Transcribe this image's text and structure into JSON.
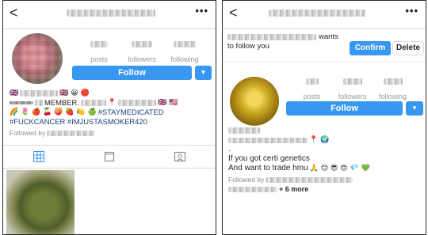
{
  "left": {
    "nav": {
      "back_icon": "chevron-left-icon",
      "back_glyph": "<",
      "more_glyph": "•••"
    },
    "stats": [
      {
        "label": "posts"
      },
      {
        "label": "followers"
      },
      {
        "label": "following"
      }
    ],
    "follow_label": "Follow",
    "caret_glyph": "▼",
    "bio": {
      "flags_a": "🇬🇧",
      "flags_b": "🇬🇧 😀 🔴",
      "member_text": "MEMBER.",
      "pin": "📍",
      "flags_c": "🇬🇧 🇺🇸",
      "emoji_row": "🌈 🌷 🍎 🍒 🍑 🍓 🍋 🍏",
      "staymedicated": "#STAYMEDICATED",
      "hashtags": "#FUCKCANCER #IMJUSTASMOKER420",
      "followed_by": "Followed by"
    },
    "tabs": [
      {
        "name": "grid-icon"
      },
      {
        "name": "list-icon"
      },
      {
        "name": "tagged-icon"
      }
    ]
  },
  "right": {
    "nav": {
      "back_glyph": "<",
      "more_glyph": "•••"
    },
    "request_text": "wants",
    "request_text_2": "to follow you",
    "confirm_label": "Confirm",
    "delete_label": "Delete",
    "stats": [
      {
        "label": "posts"
      },
      {
        "label": "followers"
      },
      {
        "label": "following"
      }
    ],
    "follow_label": "Follow",
    "caret_glyph": "▼",
    "bio": {
      "dot": ".",
      "pin_globe": "📍 🌍",
      "line1": "If you got certi genetics",
      "line2": "And want to trade hmu",
      "line2_emoji": "🙏 😊 😎 😍 💎 💚",
      "followed_by": "Followed by",
      "more_count": "+ 6 more"
    }
  },
  "colors": {
    "accent": "#3897f0",
    "hashtag": "#1b3f78",
    "muted": "#8e8e8e"
  }
}
